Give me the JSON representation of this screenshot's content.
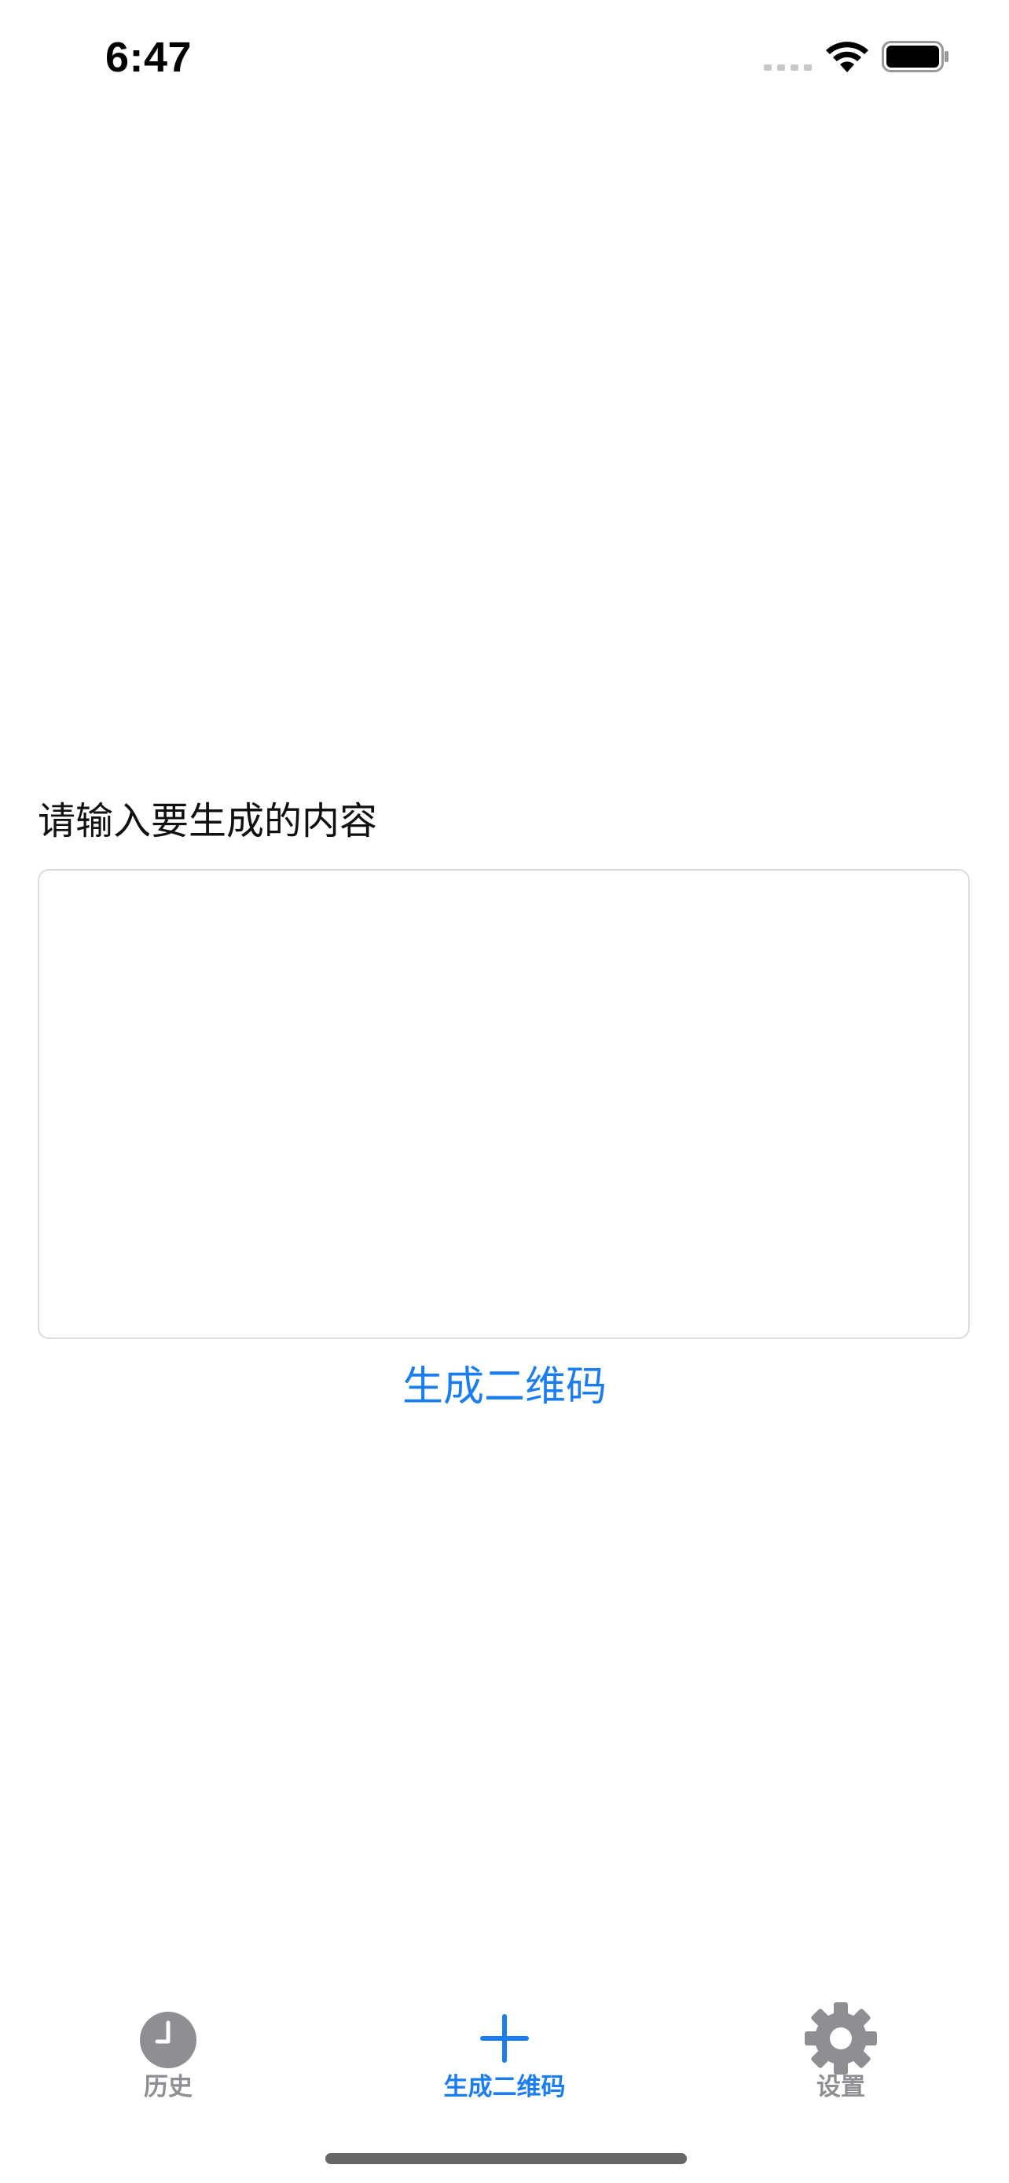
{
  "status_bar": {
    "time": "6:47"
  },
  "main": {
    "prompt_label": "请输入要生成的内容",
    "input_value": "",
    "input_placeholder": "",
    "generate_button_label": "生成二维码"
  },
  "tab_bar": {
    "tabs": [
      {
        "label": "历史",
        "icon": "clock-icon",
        "active": false
      },
      {
        "label": "生成二维码",
        "icon": "plus-icon",
        "active": true
      },
      {
        "label": "设置",
        "icon": "gear-icon",
        "active": false
      }
    ]
  },
  "colors": {
    "accent": "#1a7ef2",
    "inactive": "#8e8e93",
    "border": "#dcdcdc"
  }
}
